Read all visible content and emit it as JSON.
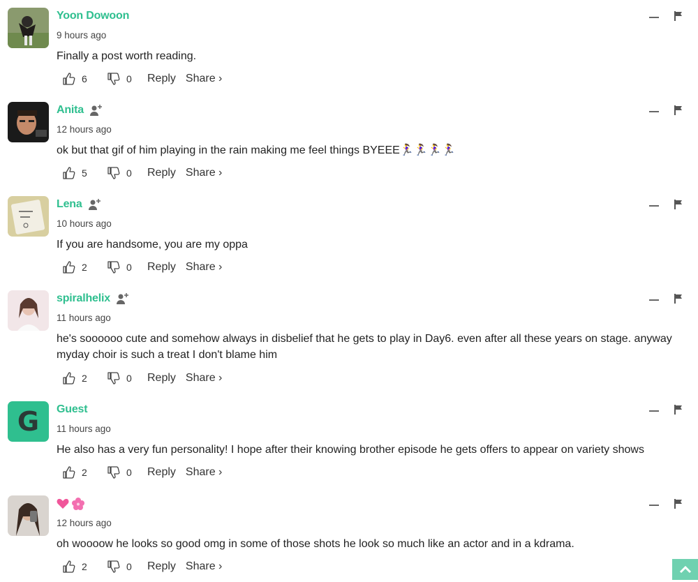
{
  "comments": [
    {
      "author": "Yoon Dowoon",
      "time": "9 hours ago",
      "text": "Finally a post worth reading.",
      "likes": "6",
      "dislikes": "0",
      "reply_label": "Reply",
      "share_label": "Share ›"
    },
    {
      "author": "Anita",
      "time": "12 hours ago",
      "text": "ok but that gif of him playing in the rain making me feel things BYEEE🏃‍♀️🏃‍♀️🏃‍♀️🏃‍♀️",
      "likes": "5",
      "dislikes": "0",
      "reply_label": "Reply",
      "share_label": "Share ›"
    },
    {
      "author": "Lena",
      "time": "10 hours ago",
      "text": "If you are handsome, you are my oppa",
      "likes": "2",
      "dislikes": "0",
      "reply_label": "Reply",
      "share_label": "Share ›"
    },
    {
      "author": "spiralhelix",
      "time": "11 hours ago",
      "text": "he's soooooo cute and somehow always in disbelief that he gets to play in Day6. even after all these years on stage. anyway myday choir is such a treat I don't blame him",
      "likes": "2",
      "dislikes": "0",
      "reply_label": "Reply",
      "share_label": "Share ›"
    },
    {
      "author": "Guest",
      "avatar_letter": "G",
      "time": "11 hours ago",
      "text": "He also has a very fun personality! I hope after their knowing brother episode he gets offers to appear on variety shows",
      "likes": "2",
      "dislikes": "0",
      "reply_label": "Reply",
      "share_label": "Share ›"
    },
    {
      "author": "💗🌸",
      "time": "12 hours ago",
      "text": "oh woooow he looks so good omg in some of those shots he look so much like an actor and in a kdrama.",
      "likes": "2",
      "dislikes": "0",
      "reply_label": "Reply",
      "share_label": "Share ›"
    }
  ],
  "colors": {
    "accent": "#2fbf8f",
    "scroll_top_bg": "#6fd1b0"
  },
  "icons": {
    "like": "thumbs-up-icon",
    "dislike": "thumbs-down-icon",
    "follow": "add-user-icon",
    "minimize": "minimize-icon",
    "flag": "flag-icon",
    "scroll_top": "chevron-up-icon"
  }
}
